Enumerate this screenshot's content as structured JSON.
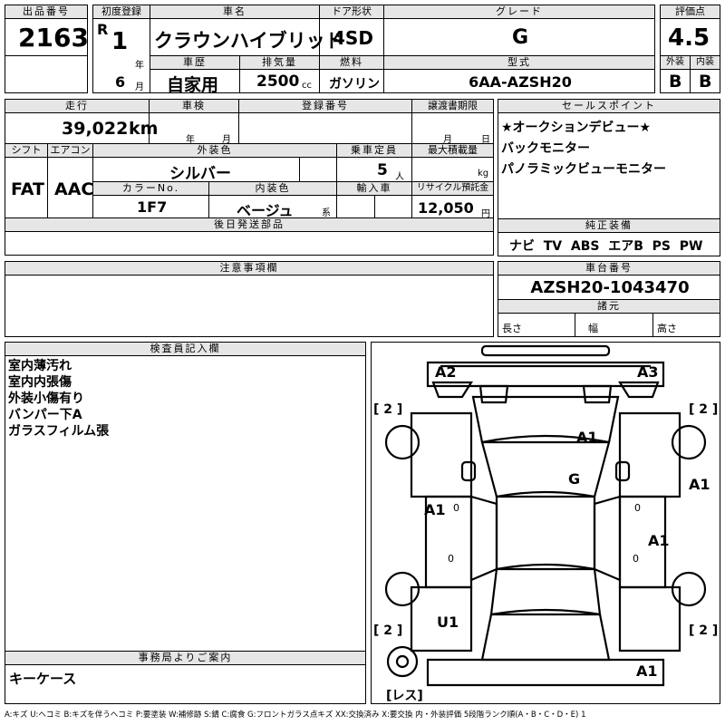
{
  "headers": {
    "lot_no": "出品番号",
    "first_reg": "初度登録",
    "car_name": "車名",
    "door": "ドア形状",
    "grade": "グレード",
    "score": "評価点",
    "history": "車歴",
    "displacement": "排気量",
    "fuel": "燃料",
    "model_code": "型式",
    "exterior": "外装",
    "interior": "内装",
    "mileage": "走行",
    "inspection": "車検",
    "reg_no": "登録番号",
    "transfer": "譲渡書期限",
    "selling_points": "セールスポイント",
    "shift": "シフト",
    "aircon": "エアコン",
    "ext_color": "外装色",
    "capacity": "乗車定員",
    "max_load": "最大積載量",
    "color_no": "カラーNo.",
    "int_color": "内装色",
    "import": "輸入車",
    "recycle": "リサイクル預託金",
    "later_parts": "後日発送部品",
    "options": "純正装備",
    "notes": "注意事項欄",
    "chassis": "車台番号",
    "specs": "諸元",
    "inspector": "検査員記入欄",
    "office": "事務局よりご案内"
  },
  "vehicle": {
    "lot_no": "2163",
    "era": "R",
    "reg_year": "1",
    "reg_month": "6",
    "year_unit": "年",
    "month_unit": "月",
    "car_name": "クラウンハイブリッド",
    "door": "4SD",
    "grade": "G",
    "score": "4.5",
    "history": "自家用",
    "displacement": "2500",
    "displacement_unit": "cc",
    "fuel": "ガソリン",
    "model_code": "6AA-AZSH20",
    "exterior_grade": "B",
    "interior_grade": "B",
    "mileage": "39,022",
    "mileage_unit": "km",
    "insp_year_unit": "年",
    "insp_month_unit": "月",
    "transfer_month_unit": "月",
    "transfer_day_unit": "日",
    "shift": "FAT",
    "aircon": "AAC",
    "ext_color": "シルバー",
    "capacity": "5",
    "capacity_unit": "人",
    "load_unit": "kg",
    "color_no": "1F7",
    "int_color": "ベージュ",
    "int_color_suffix": "系",
    "recycle": "12,050",
    "recycle_unit": "円",
    "chassis": "AZSH20-1043470",
    "spec_length": "長さ",
    "spec_width": "幅",
    "spec_height": "高さ"
  },
  "selling_points": [
    "★オークションデビュー★",
    "バックモニター",
    "パノラミックビューモニター"
  ],
  "options": [
    "ナビ",
    "TV",
    "ABS",
    "エアB",
    "PS",
    "PW"
  ],
  "inspector_notes": [
    "室内薄汚れ",
    "室内内張傷",
    "外装小傷有り",
    "バンパー下A",
    "ガラスフィルム張"
  ],
  "office_note": "キーケース",
  "diagram": {
    "tire_marks": [
      "[ 2 ]",
      "[ 2 ]",
      "[ 2 ]",
      "[ 2 ]"
    ],
    "spare": "[レス]",
    "marks": {
      "front_left": "A2",
      "front_right": "A3",
      "hood": "A1",
      "roof": "G",
      "left_door": "A1",
      "right_front_fender": "A1",
      "right_door": "A1",
      "left_rear": "U1",
      "rear": "A1"
    },
    "small_zero": "0"
  },
  "legend": "A:キズ U:ヘコミ B:キズを伴うヘコミ P:要塗装 W:補修跡 S:錆 C:腐食 G:フロントガラス点キズ XX:交換済み X:要交換 内・外装評価 5段階ランク順(A・B・C・D・E) 1"
}
